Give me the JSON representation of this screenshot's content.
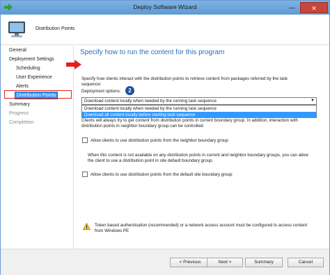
{
  "window": {
    "title": "Deploy Software Wizard",
    "minimize_glyph": "—",
    "close_glyph": "✕"
  },
  "header": {
    "title": "Distribution Points",
    "icon": "computer-icon"
  },
  "nav": {
    "items": [
      {
        "label": "General",
        "state": "normal"
      },
      {
        "label": "Deployment Settings",
        "state": "normal"
      },
      {
        "label": "Scheduling",
        "state": "normal"
      },
      {
        "label": "User Experience",
        "state": "normal"
      },
      {
        "label": "Alerts",
        "state": "normal"
      },
      {
        "label": "Distribution Points",
        "state": "selected"
      },
      {
        "label": "Summary",
        "state": "normal"
      },
      {
        "label": "Progress",
        "state": "disabled"
      },
      {
        "label": "Completion",
        "state": "disabled"
      }
    ]
  },
  "content": {
    "heading": "Specify how to run the content for this program",
    "intro_line1": "Specify how clients interact with the distribution points to retrieve content from packages referred by the task",
    "intro_line2": "sequence:",
    "options_label": "Deployment options:",
    "badge": "2",
    "select": {
      "value": "Download content locally when needed by the running task sequence",
      "options": [
        "Download content locally when needed by the running task sequence",
        "Download all content locally before starting task sequence"
      ],
      "selected_index": 1
    },
    "clients_line1": "Clients will always try to get content from distribution points in current boundary group. In addition, interaction with",
    "clients_line2": "distribution points in neighbor boundary group can be controlled:",
    "checkbox_neighbor": "Allow clients to use distribution points from the neighbor boundary group",
    "fallback_line1": "When this content is not available on any distribution points in current and neighbor boundary groups, you can allow",
    "fallback_line2": "the client to use a distribution point in site default boundary group.",
    "checkbox_default": "Allow clients to use distribution points from the default site boundary group",
    "warning_line1": "Token based authentication (recommended) or a network access account must be configured to access content",
    "warning_line2": "from Windows PE"
  },
  "footer": {
    "previous": "< Previous",
    "next": "Next >",
    "summary": "Summary",
    "cancel": "Cancel"
  },
  "colors": {
    "accent": "#2a6ebb",
    "selection": "#3399ff",
    "highlight_box": "#e02020",
    "titlebar": "#6fa8dc"
  }
}
